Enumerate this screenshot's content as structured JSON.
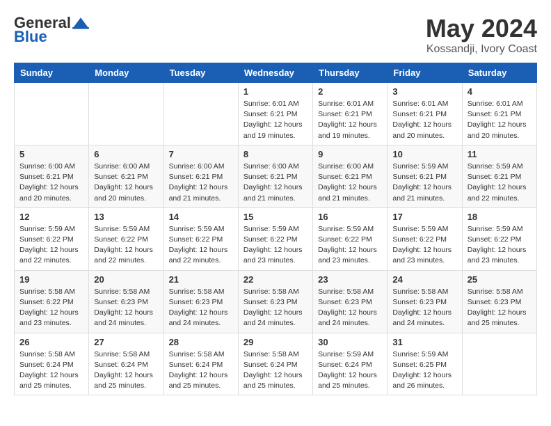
{
  "header": {
    "logo": {
      "general": "General",
      "blue": "Blue"
    },
    "title": "May 2024",
    "location": "Kossandji, Ivory Coast"
  },
  "calendar": {
    "weekdays": [
      "Sunday",
      "Monday",
      "Tuesday",
      "Wednesday",
      "Thursday",
      "Friday",
      "Saturday"
    ],
    "weeks": [
      [
        null,
        null,
        null,
        {
          "day": 1,
          "sunrise": "6:01 AM",
          "sunset": "6:21 PM",
          "daylight": "12 hours and 19 minutes."
        },
        {
          "day": 2,
          "sunrise": "6:01 AM",
          "sunset": "6:21 PM",
          "daylight": "12 hours and 19 minutes."
        },
        {
          "day": 3,
          "sunrise": "6:01 AM",
          "sunset": "6:21 PM",
          "daylight": "12 hours and 20 minutes."
        },
        {
          "day": 4,
          "sunrise": "6:01 AM",
          "sunset": "6:21 PM",
          "daylight": "12 hours and 20 minutes."
        }
      ],
      [
        {
          "day": 5,
          "sunrise": "6:00 AM",
          "sunset": "6:21 PM",
          "daylight": "12 hours and 20 minutes."
        },
        {
          "day": 6,
          "sunrise": "6:00 AM",
          "sunset": "6:21 PM",
          "daylight": "12 hours and 20 minutes."
        },
        {
          "day": 7,
          "sunrise": "6:00 AM",
          "sunset": "6:21 PM",
          "daylight": "12 hours and 21 minutes."
        },
        {
          "day": 8,
          "sunrise": "6:00 AM",
          "sunset": "6:21 PM",
          "daylight": "12 hours and 21 minutes."
        },
        {
          "day": 9,
          "sunrise": "6:00 AM",
          "sunset": "6:21 PM",
          "daylight": "12 hours and 21 minutes."
        },
        {
          "day": 10,
          "sunrise": "5:59 AM",
          "sunset": "6:21 PM",
          "daylight": "12 hours and 21 minutes."
        },
        {
          "day": 11,
          "sunrise": "5:59 AM",
          "sunset": "6:21 PM",
          "daylight": "12 hours and 22 minutes."
        }
      ],
      [
        {
          "day": 12,
          "sunrise": "5:59 AM",
          "sunset": "6:22 PM",
          "daylight": "12 hours and 22 minutes."
        },
        {
          "day": 13,
          "sunrise": "5:59 AM",
          "sunset": "6:22 PM",
          "daylight": "12 hours and 22 minutes."
        },
        {
          "day": 14,
          "sunrise": "5:59 AM",
          "sunset": "6:22 PM",
          "daylight": "12 hours and 22 minutes."
        },
        {
          "day": 15,
          "sunrise": "5:59 AM",
          "sunset": "6:22 PM",
          "daylight": "12 hours and 23 minutes."
        },
        {
          "day": 16,
          "sunrise": "5:59 AM",
          "sunset": "6:22 PM",
          "daylight": "12 hours and 23 minutes."
        },
        {
          "day": 17,
          "sunrise": "5:59 AM",
          "sunset": "6:22 PM",
          "daylight": "12 hours and 23 minutes."
        },
        {
          "day": 18,
          "sunrise": "5:59 AM",
          "sunset": "6:22 PM",
          "daylight": "12 hours and 23 minutes."
        }
      ],
      [
        {
          "day": 19,
          "sunrise": "5:58 AM",
          "sunset": "6:22 PM",
          "daylight": "12 hours and 23 minutes."
        },
        {
          "day": 20,
          "sunrise": "5:58 AM",
          "sunset": "6:23 PM",
          "daylight": "12 hours and 24 minutes."
        },
        {
          "day": 21,
          "sunrise": "5:58 AM",
          "sunset": "6:23 PM",
          "daylight": "12 hours and 24 minutes."
        },
        {
          "day": 22,
          "sunrise": "5:58 AM",
          "sunset": "6:23 PM",
          "daylight": "12 hours and 24 minutes."
        },
        {
          "day": 23,
          "sunrise": "5:58 AM",
          "sunset": "6:23 PM",
          "daylight": "12 hours and 24 minutes."
        },
        {
          "day": 24,
          "sunrise": "5:58 AM",
          "sunset": "6:23 PM",
          "daylight": "12 hours and 24 minutes."
        },
        {
          "day": 25,
          "sunrise": "5:58 AM",
          "sunset": "6:23 PM",
          "daylight": "12 hours and 25 minutes."
        }
      ],
      [
        {
          "day": 26,
          "sunrise": "5:58 AM",
          "sunset": "6:24 PM",
          "daylight": "12 hours and 25 minutes."
        },
        {
          "day": 27,
          "sunrise": "5:58 AM",
          "sunset": "6:24 PM",
          "daylight": "12 hours and 25 minutes."
        },
        {
          "day": 28,
          "sunrise": "5:58 AM",
          "sunset": "6:24 PM",
          "daylight": "12 hours and 25 minutes."
        },
        {
          "day": 29,
          "sunrise": "5:58 AM",
          "sunset": "6:24 PM",
          "daylight": "12 hours and 25 minutes."
        },
        {
          "day": 30,
          "sunrise": "5:59 AM",
          "sunset": "6:24 PM",
          "daylight": "12 hours and 25 minutes."
        },
        {
          "day": 31,
          "sunrise": "5:59 AM",
          "sunset": "6:25 PM",
          "daylight": "12 hours and 26 minutes."
        },
        null
      ]
    ]
  }
}
